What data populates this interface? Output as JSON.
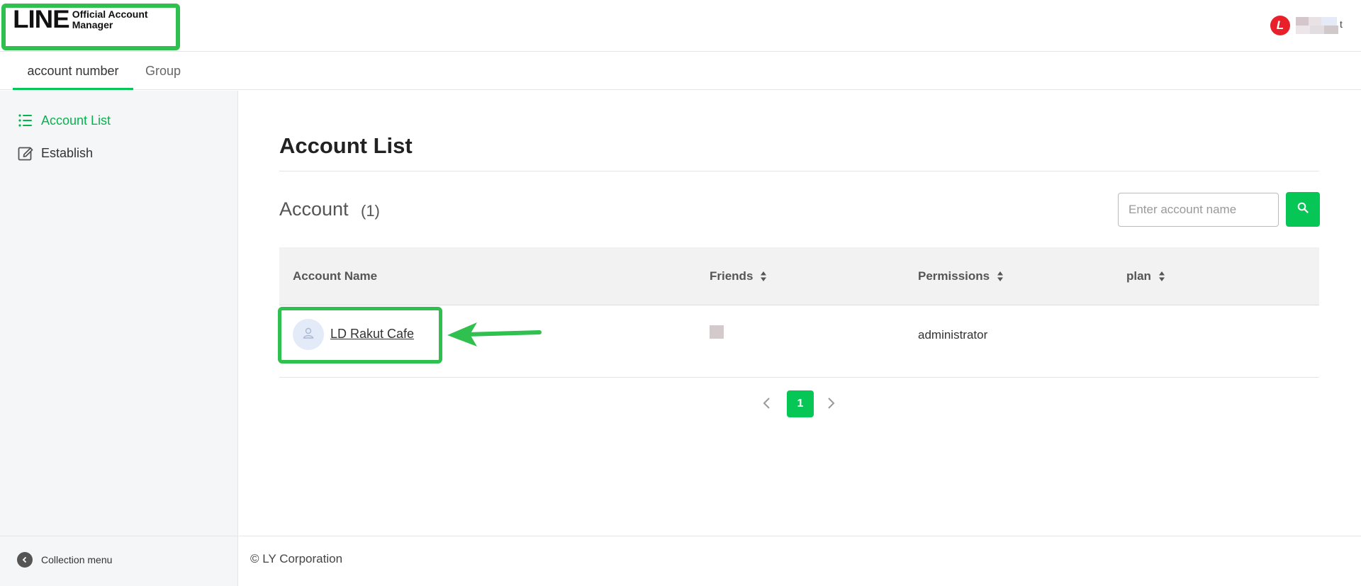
{
  "header": {
    "logo_main": "LINE",
    "logo_sub_line1": "Official Account",
    "logo_sub_line2": "Manager",
    "user_avatar_letter": "L",
    "user_name_suffix": "t"
  },
  "tabs": [
    {
      "label": "account number",
      "active": true
    },
    {
      "label": "Group",
      "active": false
    }
  ],
  "sidebar": {
    "items": [
      {
        "label": "Account List",
        "icon": "list-icon",
        "active": true
      },
      {
        "label": "Establish",
        "icon": "edit-icon",
        "active": false
      }
    ],
    "collapse_label": "Collection menu"
  },
  "main": {
    "page_title": "Account List",
    "section_title": "Account",
    "section_count": "(1)",
    "search": {
      "placeholder": "Enter account name",
      "value": ""
    },
    "table": {
      "columns": [
        "Account Name",
        "Friends",
        "Permissions",
        "plan"
      ],
      "rows": [
        {
          "account_name": "LD Rakut Cafe",
          "friends": "",
          "permissions": "administrator",
          "plan": ""
        }
      ]
    },
    "pagination": {
      "current": "1"
    }
  },
  "footer": {
    "copyright": "© LY Corporation"
  },
  "colors": {
    "brand_green": "#06c755",
    "highlight_green": "#2fc04f",
    "avatar_red": "#e8202a"
  }
}
